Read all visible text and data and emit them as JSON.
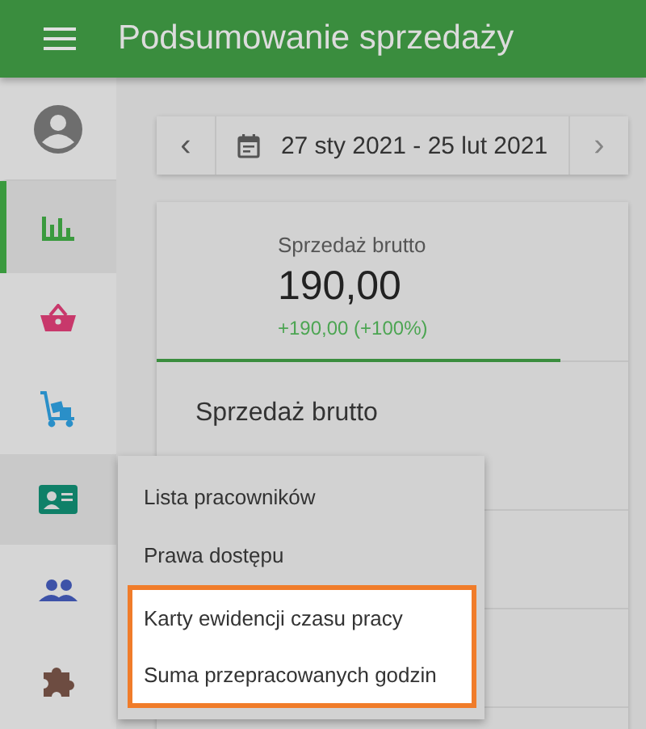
{
  "header": {
    "title": "Podsumowanie sprzedaży"
  },
  "sidebar": {
    "items": [
      {
        "kind": "profile",
        "selected": false
      },
      {
        "kind": "chart",
        "selected": true
      },
      {
        "kind": "basket",
        "selected": false
      },
      {
        "kind": "trolley",
        "selected": false
      },
      {
        "kind": "idcard",
        "selected": false,
        "expanded": true
      },
      {
        "kind": "people",
        "selected": false
      },
      {
        "kind": "puzzle",
        "selected": false
      }
    ]
  },
  "date_range": {
    "prev": "‹",
    "label": "27 sty 2021 - 25 lut 2021",
    "next": "›"
  },
  "summary_card": {
    "tab_label": "Sprzedaż brutto",
    "value": "190,00",
    "change": "+190,00 (+100%)",
    "section_title": "Sprzedaż brutto"
  },
  "menu": {
    "items": [
      {
        "label": "Lista pracowników",
        "highlighted": false
      },
      {
        "label": "Prawa dostępu",
        "highlighted": false
      },
      {
        "label": "Karty ewidencji czasu pracy",
        "highlighted": true
      },
      {
        "label": "Suma przepracowanych godzin",
        "highlighted": true
      }
    ]
  }
}
